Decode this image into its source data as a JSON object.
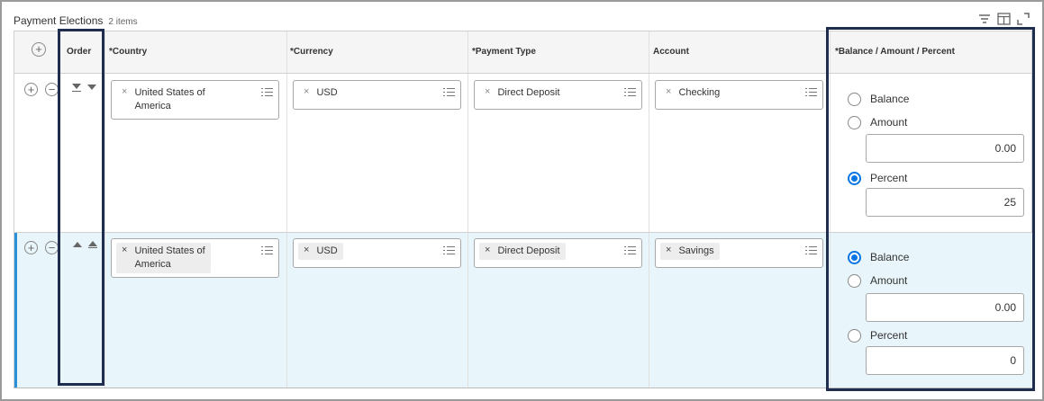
{
  "grid": {
    "title": "Payment Elections",
    "count": "2 items",
    "headers": {
      "order": "Order",
      "country": "*Country",
      "currency": "*Currency",
      "payment_type": "*Payment Type",
      "account": "Account",
      "balance": "*Balance / Amount / Percent"
    },
    "toolbar_icons": [
      "filter-icon",
      "columns-icon",
      "fullscreen-icon"
    ]
  },
  "rows": [
    {
      "country": [
        "United States of",
        "America"
      ],
      "currency": "USD",
      "payment_type": "Direct Deposit",
      "account": "Checking",
      "options": {
        "balance": "Balance",
        "amount": "Amount",
        "percent": "Percent"
      },
      "selected": "Percent",
      "amount_value": "0.00",
      "percent_value": "25"
    },
    {
      "country": [
        "United States of",
        "America"
      ],
      "currency": "USD",
      "payment_type": "Direct Deposit",
      "account": "Savings",
      "options": {
        "balance": "Balance",
        "amount": "Amount",
        "percent": "Percent"
      },
      "selected": "Balance",
      "amount_value": "0.00",
      "percent_value": "0"
    }
  ],
  "colors": {
    "accent": "#0875e1",
    "highlight_border": "#1f2d4f",
    "selected_row_bg": "#e8f5fb"
  }
}
